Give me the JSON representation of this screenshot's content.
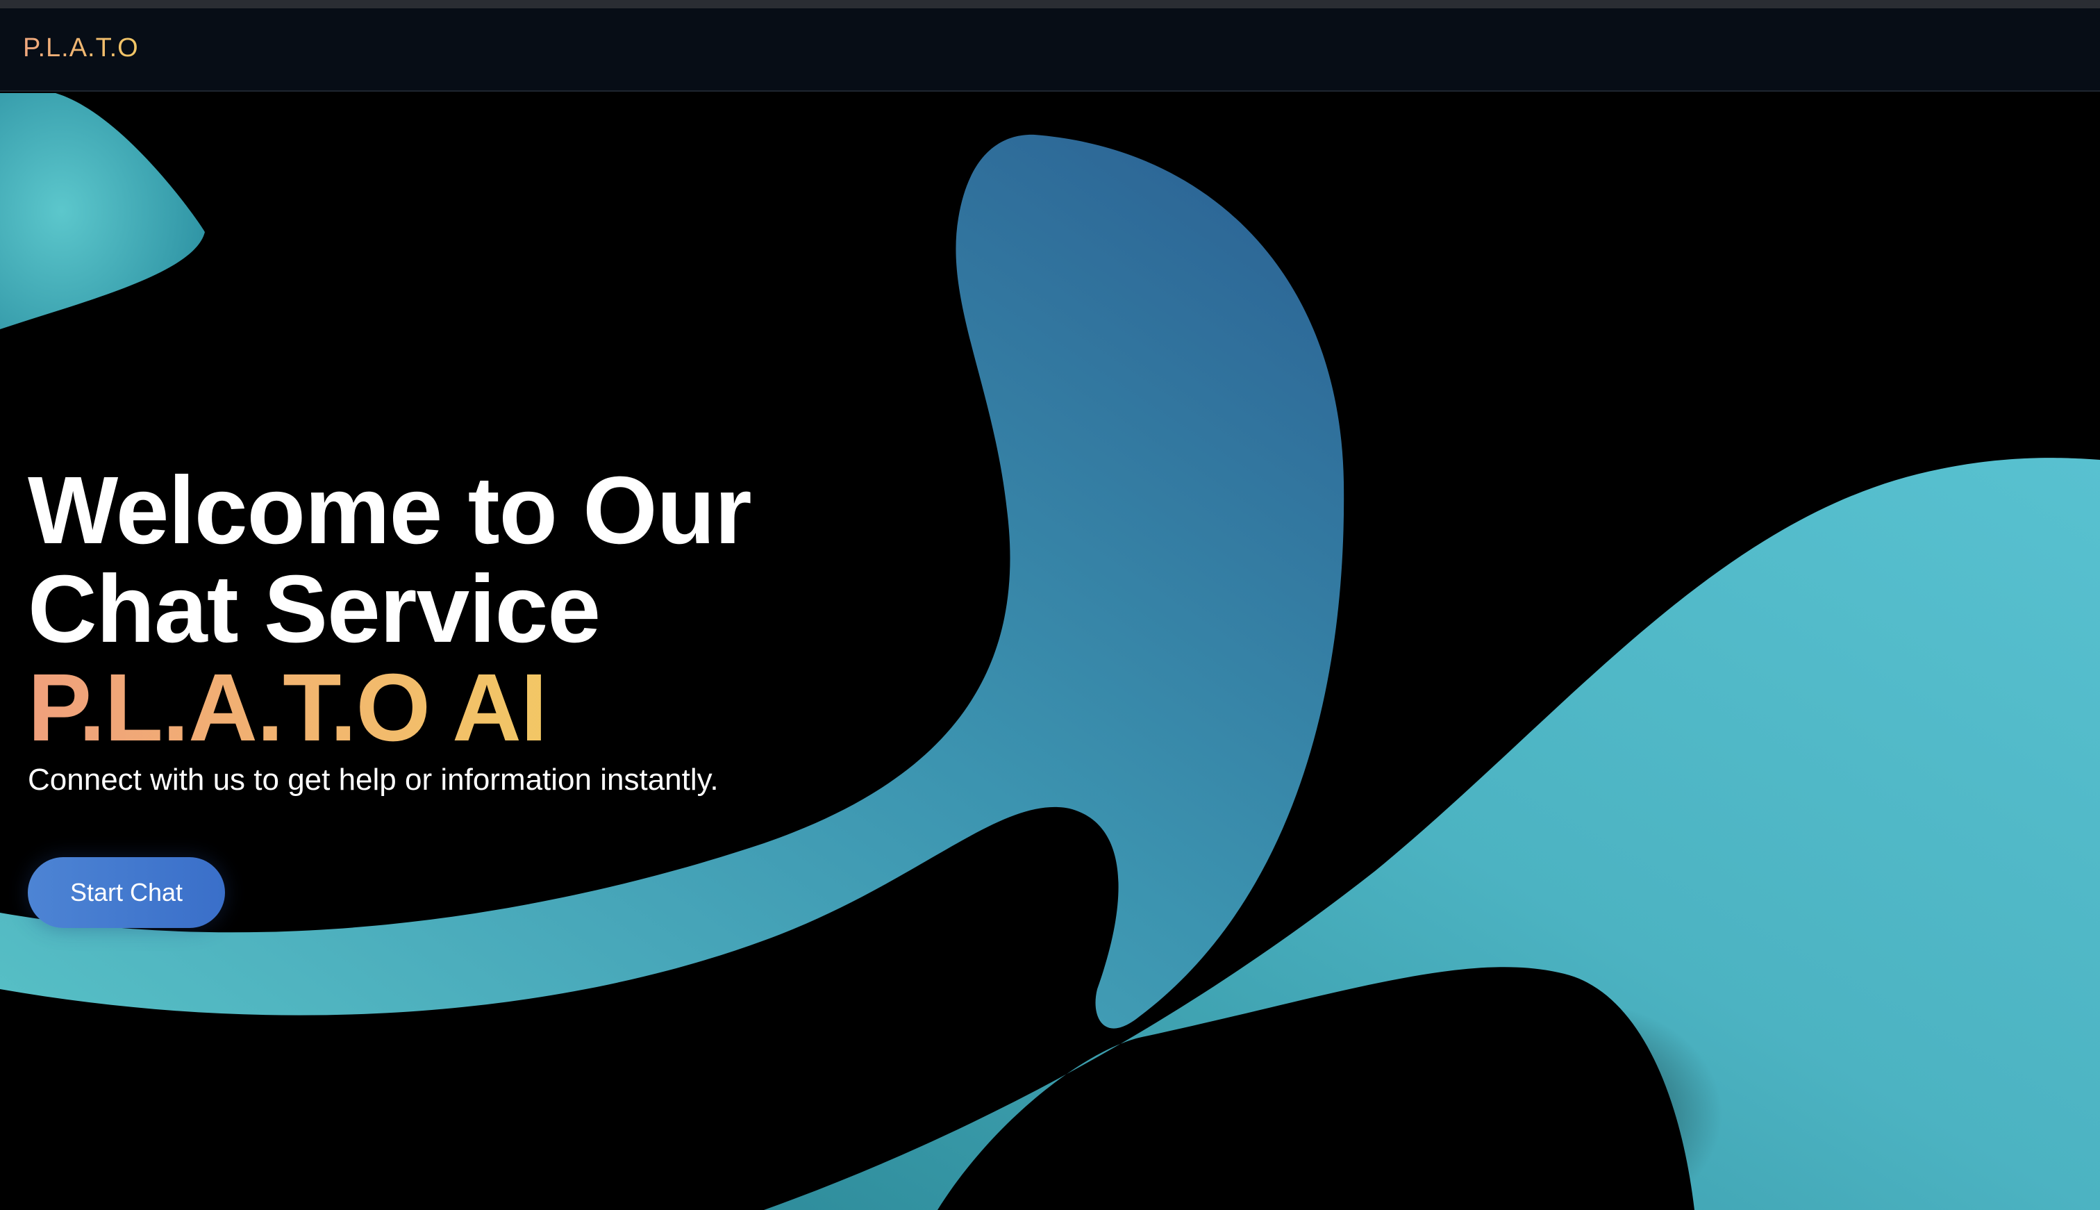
{
  "navbar": {
    "brand": "P.L.A.T.O"
  },
  "hero": {
    "headline_line1": "Welcome to Our",
    "headline_line2": "Chat Service",
    "headline_accent": "P.L.A.T.O AI",
    "subtitle": "Connect with us to get help or information instantly.",
    "cta_label": "Start Chat"
  },
  "colors": {
    "background": "#000000",
    "navbar_bg": "#070d16",
    "accent_gradient_start": "#f0a07c",
    "accent_gradient_end": "#f3cc62",
    "button_start": "#4d84d4",
    "button_end": "#3a6fc9",
    "shape_teal": "#4fb8c8",
    "shape_blue": "#2f6f9c"
  }
}
